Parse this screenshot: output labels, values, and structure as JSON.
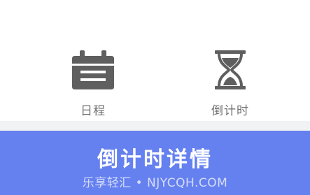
{
  "nav": {
    "items": [
      {
        "label": "日程",
        "icon": "calendar-icon"
      },
      {
        "label": "倒计时",
        "icon": "hourglass-icon"
      }
    ]
  },
  "action": {
    "label": "倒计时详情"
  },
  "watermark": {
    "text": "乐享轻汇 • NJYCQH.COM"
  },
  "colors": {
    "icon": "#5f5f5f",
    "label": "#6e6e6e",
    "separator": "#f1f2f4",
    "action_bar": "#6580ef",
    "action_text": "#ffffff"
  }
}
